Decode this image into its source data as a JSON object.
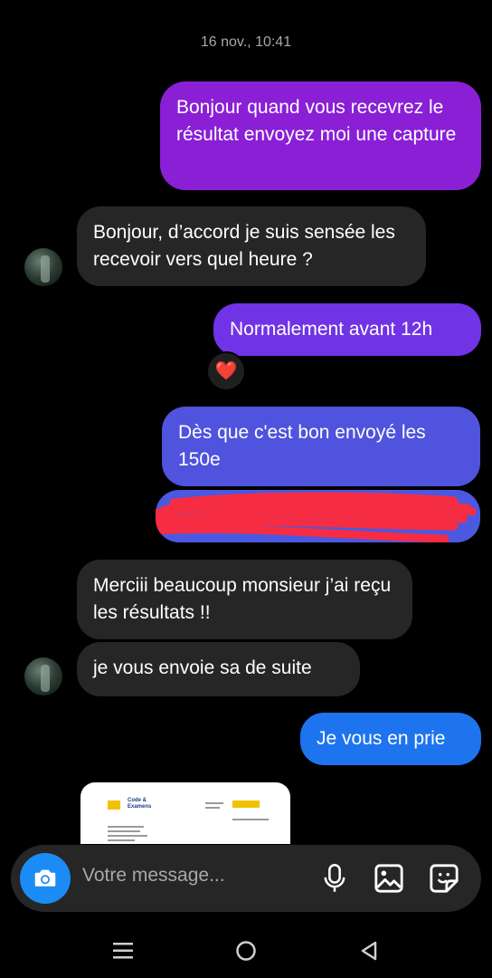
{
  "timestamp": "16 nov., 10:41",
  "messages": [
    {
      "side": "sent",
      "text": "Bonjour quand vous recevrez le résultat envoyez moi une capture"
    },
    {
      "side": "received",
      "text": "Bonjour, d’accord je suis sensée les recevoir vers quel heure ?"
    },
    {
      "side": "sent",
      "text": "Normalement avant 12h"
    },
    {
      "side": "sent",
      "text": "Dès que c'est bon envoyé les 150e"
    },
    {
      "side": "received",
      "text": "Merciii beaucoup monsieur j’ai reçu les résultats !!"
    },
    {
      "side": "received",
      "text": "je vous envoie sa de suite"
    },
    {
      "side": "sent",
      "text": "Je vous en prie"
    }
  ],
  "reaction": "❤️",
  "image_preview": {
    "brand_line1": "Code &",
    "brand_line2": "Examens"
  },
  "composer": {
    "placeholder": "Votre message..."
  },
  "icons": [
    "camera-icon",
    "microphone-icon",
    "gallery-icon",
    "sticker-icon",
    "recents-icon",
    "home-icon",
    "back-icon"
  ],
  "colors": {
    "sent_purple": "#8a1fd6",
    "sent_blue": "#1d74ee",
    "received": "#262626",
    "camera_button": "#1b8cf6"
  }
}
